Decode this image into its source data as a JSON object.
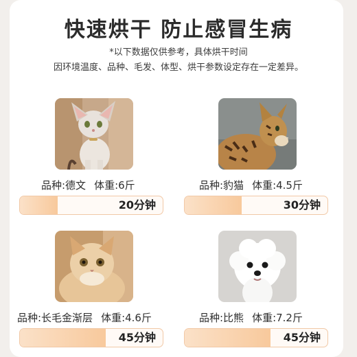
{
  "title": "快速烘干 防止感冒生病",
  "note_line1": "*以下数据仅供参考，具体烘干时间",
  "note_line2": "因环境温度、品种、毛发、体型、烘干参数设定存在一定差异。",
  "pets": [
    {
      "breed": "品种:德文",
      "weight": "体重:6斤",
      "time": "20分钟",
      "progress_minutes": 20,
      "photo": "devon-rex-cat-photo"
    },
    {
      "breed": "品种:豹猫",
      "weight": "体重:4.5斤",
      "time": "30分钟",
      "progress_minutes": 30,
      "photo": "bengal-cat-photo"
    },
    {
      "breed": "品种:长毛金渐层",
      "weight": "体重:4.6斤",
      "time": "45分钟",
      "progress_minutes": 45,
      "photo": "golden-longhair-cat-photo"
    },
    {
      "breed": "品种:比熊",
      "weight": "体重:7.2斤",
      "time": "45分钟",
      "progress_minutes": 45,
      "photo": "bichon-dog-photo"
    }
  ],
  "colors": {
    "bar_fill": "#f8c99c",
    "bar_border": "#f1c8a6",
    "title": "#2b2b2b"
  }
}
